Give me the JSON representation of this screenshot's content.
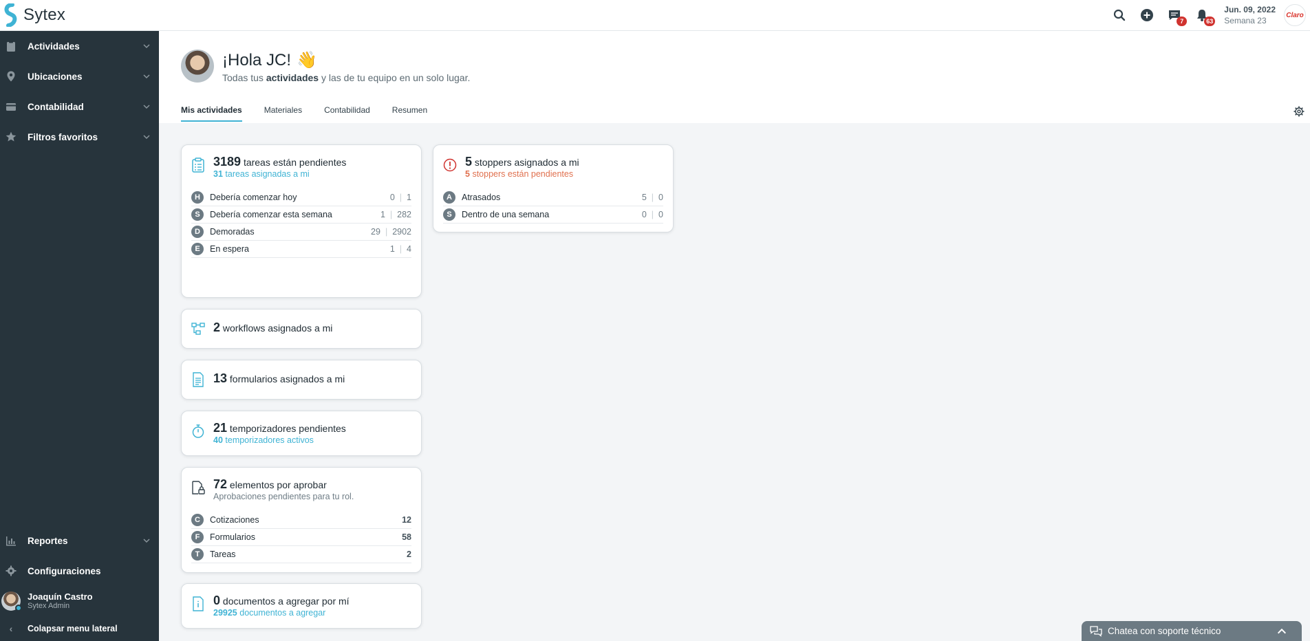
{
  "topbar": {
    "brand": "Sytex",
    "messages_badge": "7",
    "notifications_badge": "63",
    "date": "Jun. 09, 2022",
    "week": "Semana 23",
    "org_logo": "Claro"
  },
  "sidebar": {
    "items": [
      {
        "label": "Actividades",
        "icon": "clipboard-icon"
      },
      {
        "label": "Ubicaciones",
        "icon": "map-pin-icon"
      },
      {
        "label": "Contabilidad",
        "icon": "wallet-icon"
      },
      {
        "label": "Filtros favoritos",
        "icon": "star-icon"
      }
    ],
    "bottom_items": [
      {
        "label": "Reportes",
        "icon": "bar-chart-icon"
      },
      {
        "label": "Configuraciones",
        "icon": "gear-icon"
      }
    ],
    "user": {
      "name": "Joaquín Castro",
      "role": "Sytex Admin"
    },
    "collapse_label": "Colapsar menu lateral"
  },
  "header": {
    "greeting": "¡Hola JC!",
    "wave": "👋",
    "subtitle_pre": "Todas tus ",
    "subtitle_bold": "actividades",
    "subtitle_post": " y las de tu equipo en un solo lugar."
  },
  "tabs": [
    "Mis actividades",
    "Materiales",
    "Contabilidad",
    "Resumen"
  ],
  "cards": {
    "tasks": {
      "count": "3189",
      "title": "tareas están pendientes",
      "sub_count": "31",
      "sub_text": "tareas asignadas a mi",
      "rows": [
        {
          "badge": "H",
          "label": "Debería comenzar hoy",
          "mine": "0",
          "total": "1"
        },
        {
          "badge": "S",
          "label": "Debería comenzar esta semana",
          "mine": "1",
          "total": "282"
        },
        {
          "badge": "D",
          "label": "Demoradas",
          "mine": "29",
          "total": "2902"
        },
        {
          "badge": "E",
          "label": "En espera",
          "mine": "1",
          "total": "4"
        }
      ]
    },
    "stoppers": {
      "count": "5",
      "title": "stoppers asignados a mi",
      "sub_count": "5",
      "sub_text": "stoppers están pendientes",
      "rows": [
        {
          "badge": "A",
          "label": "Atrasados",
          "mine": "5",
          "total": "0"
        },
        {
          "badge": "S",
          "label": "Dentro de una semana",
          "mine": "0",
          "total": "0"
        }
      ]
    },
    "workflows": {
      "count": "2",
      "title": "workflows asignados a mi"
    },
    "forms": {
      "count": "13",
      "title": "formularios asignados a mi"
    },
    "timers": {
      "count": "21",
      "title": "temporizadores pendientes",
      "sub_count": "40",
      "sub_text": "temporizadores activos"
    },
    "approvals": {
      "count": "72",
      "title": "elementos por aprobar",
      "sub_text": "Aprobaciones pendientes para tu rol.",
      "rows": [
        {
          "badge": "C",
          "label": "Cotizaciones",
          "value": "12"
        },
        {
          "badge": "F",
          "label": "Formularios",
          "value": "58"
        },
        {
          "badge": "T",
          "label": "Tareas",
          "value": "2"
        }
      ]
    },
    "documents": {
      "count": "0",
      "title": "documentos a agregar por mí",
      "sub_count": "29925",
      "sub_text": "documentos a agregar"
    }
  },
  "chat": {
    "label": "Chatea con soporte técnico"
  },
  "colors": {
    "sidebar": "#27343c",
    "accent": "#3fb3d4",
    "danger": "#d0332f",
    "stopper": "#e0704e"
  }
}
